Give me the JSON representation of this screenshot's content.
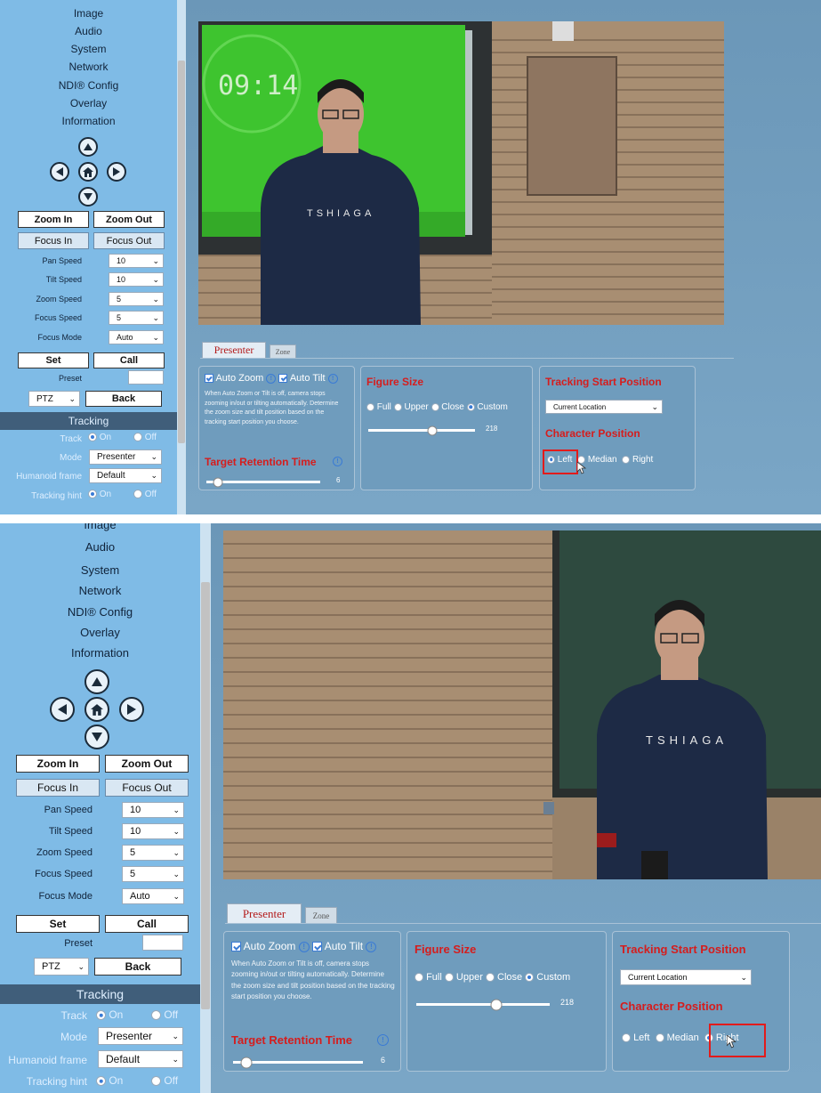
{
  "menu": [
    "Image",
    "Audio",
    "System",
    "Network",
    "NDI® Config",
    "Overlay",
    "Information"
  ],
  "ptz": {
    "zoom_in": "Zoom In",
    "zoom_out": "Zoom Out",
    "focus_in": "Focus In",
    "focus_out": "Focus Out",
    "pan_speed_label": "Pan Speed",
    "pan_speed": "10",
    "tilt_speed_label": "Tilt Speed",
    "tilt_speed": "10",
    "zoom_speed_label": "Zoom Speed",
    "zoom_speed": "5",
    "focus_speed_label": "Focus Speed",
    "focus_speed": "5",
    "focus_mode_label": "Focus Mode",
    "focus_mode": "Auto",
    "set": "Set",
    "call": "Call",
    "preset_label": "Preset",
    "preset_mode": "PTZ",
    "back": "Back"
  },
  "tracking": {
    "heading": "Tracking",
    "track_label": "Track",
    "on": "On",
    "off": "Off",
    "mode_label": "Mode",
    "mode": "Presenter",
    "humanoid_label": "Humanoid frame",
    "humanoid": "Default",
    "hint_label": "Tracking hint"
  },
  "video": {
    "clock": "09:14",
    "shirt_text": "TSHIAGA"
  },
  "tabs": {
    "presenter": "Presenter",
    "zone": "Zone"
  },
  "auto": {
    "auto_zoom": "Auto Zoom",
    "auto_tilt": "Auto Tilt",
    "desc": "When Auto Zoom or Tilt is off, camera stops zooming in/out or tilting automatically. Determine the zoom size and tilt position based on the tracking start position you choose.",
    "retention_title": "Target Retention Time",
    "retention_value": "6"
  },
  "figure": {
    "title": "Figure Size",
    "full": "Full",
    "upper": "Upper",
    "close": "Close",
    "custom": "Custom",
    "value": "218",
    "fraction": 0.6
  },
  "start": {
    "title": "Tracking Start Position",
    "location": "Current Location",
    "char_title": "Character Position",
    "left": "Left",
    "median": "Median",
    "right": "Right"
  },
  "panels": [
    {
      "character_position": "Left"
    },
    {
      "character_position": "Right"
    }
  ],
  "colors": {
    "heading_red": "#d51d1d",
    "highlight": "#e31b1b",
    "sidebar": "#7fbbe6",
    "content": "#6b97b8"
  }
}
